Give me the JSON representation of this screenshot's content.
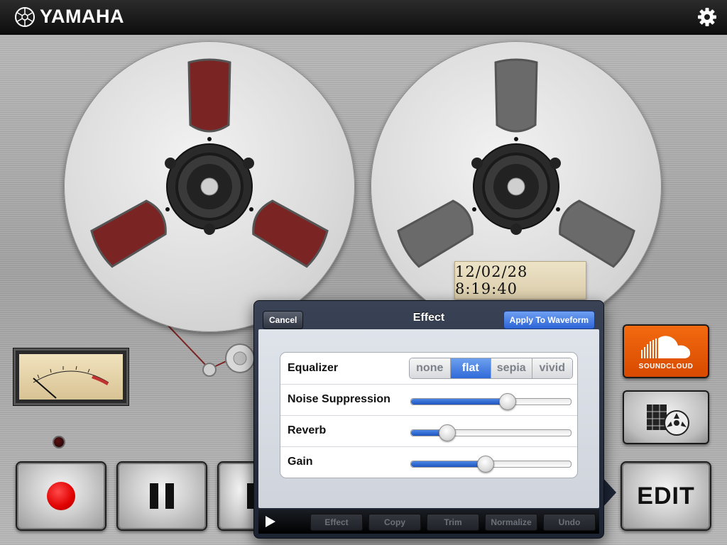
{
  "app": {
    "brand": "YAMAHA"
  },
  "icons": {
    "logo": "yamaha-tuning-fork-logo",
    "settings": "gear-icon",
    "soundcloud": "soundcloud-cloud-icon",
    "library": "tape-library-icon",
    "play": "play-icon"
  },
  "reels": {
    "left_color": "#7a2424",
    "right_color": "#6a6a6a"
  },
  "date_label": "12/02/28 8:19:40",
  "transport": {
    "edit_label": "EDIT"
  },
  "soundcloud": {
    "label": "SOUNDCLOUD",
    "color": "#f26a10"
  },
  "popover": {
    "title": "Effect",
    "cancel": "Cancel",
    "apply": "Apply To Waveform",
    "rows": {
      "equalizer": {
        "label": "Equalizer",
        "options": [
          "none",
          "flat",
          "sepia",
          "vivid"
        ],
        "selected": "flat"
      },
      "noise": {
        "label": "Noise Suppression",
        "value": 0.6
      },
      "reverb": {
        "label": "Reverb",
        "value": 0.22
      },
      "gain": {
        "label": "Gain",
        "value": 0.46
      }
    },
    "toolbar": [
      "Effect",
      "Copy",
      "Trim",
      "Normalize",
      "Undo"
    ]
  }
}
